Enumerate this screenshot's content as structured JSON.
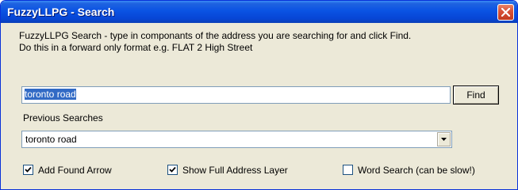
{
  "window": {
    "title": "FuzzyLLPG - Search",
    "close_label": "close"
  },
  "instructions": {
    "line1": "FuzzyLLPG Search - type in componants of the address you are searching for and click Find.",
    "line2": "Do this in a forward only format e.g. FLAT 2 High Street"
  },
  "search": {
    "value": "toronto road",
    "find_label": "Find"
  },
  "previous": {
    "label": "Previous Searches",
    "selected": "toronto road"
  },
  "options": [
    {
      "label": "Add Found Arrow",
      "checked": true
    },
    {
      "label": "Show Full Address Layer",
      "checked": true
    },
    {
      "label": "Word Search (can be slow!)",
      "checked": false
    }
  ],
  "colors": {
    "titlebar": "#0a53e3",
    "selection": "#316ac5",
    "close": "#c23a1f"
  }
}
